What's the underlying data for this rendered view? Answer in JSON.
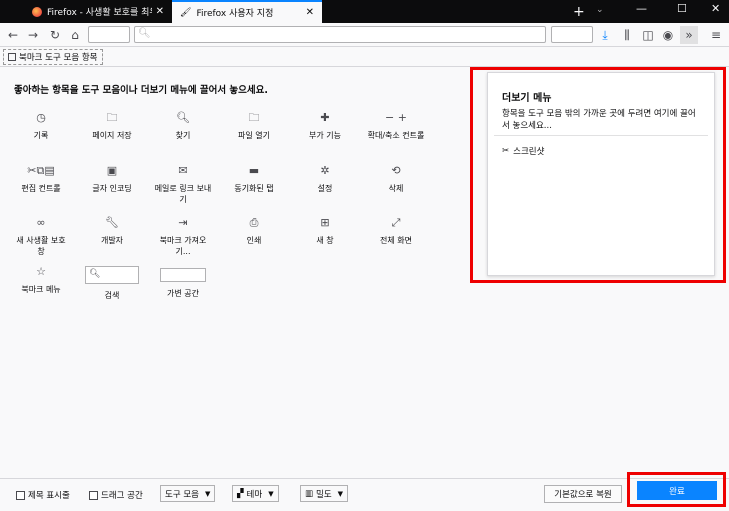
{
  "tabs": [
    {
      "title": "Firefox - 사생활 보호를 최우선"
    },
    {
      "title": "Firefox 사용자 지정"
    }
  ],
  "toolbar": {
    "new_tab": "+",
    "tab_menu": "⌄",
    "win_minimize": "—",
    "win_maximize": "☐",
    "win_close": "✕"
  },
  "bookmarks_toolbar": {
    "label": "북마크 도구 모음 항목"
  },
  "customize": {
    "heading": "좋아하는 항목을 도구 모음이나 더보기 메뉴에 끌어서 놓으세요.",
    "items": [
      {
        "label": "기록",
        "icon": "history-icon",
        "glyph": "◷"
      },
      {
        "label": "페이지 저장",
        "icon": "save-page-icon",
        "glyph": "🗀"
      },
      {
        "label": "찾기",
        "icon": "search-icon",
        "glyph": "🔍︎"
      },
      {
        "label": "파일 열기",
        "icon": "open-file-icon",
        "glyph": "🗀"
      },
      {
        "label": "부가 기능",
        "icon": "puzzle-icon",
        "glyph": "✚"
      },
      {
        "label": "확대/축소 컨트롤",
        "icon": "zoom-icon",
        "glyph": "−  +"
      },
      {
        "label": "편집 컨트롤",
        "icon": "edit-controls-icon",
        "glyph": "✂⧉▤"
      },
      {
        "label": "글자 인코딩",
        "icon": "encoding-icon",
        "glyph": "▣"
      },
      {
        "label": "메일로 링크 보내기",
        "icon": "mail-icon",
        "glyph": "✉"
      },
      {
        "label": "동기화된 탭",
        "icon": "synced-tabs-icon",
        "glyph": "▬"
      },
      {
        "label": "설정",
        "icon": "gear-icon",
        "glyph": "✲"
      },
      {
        "label": "삭제",
        "icon": "forget-icon",
        "glyph": "⟲"
      },
      {
        "label": "새 사생활 보호 창",
        "icon": "private-window-icon",
        "glyph": "∞"
      },
      {
        "label": "개발자",
        "icon": "wrench-icon",
        "glyph": "🔧︎"
      },
      {
        "label": "북마크 가져오기...",
        "icon": "import-bookmarks-icon",
        "glyph": "⇥"
      },
      {
        "label": "인쇄",
        "icon": "print-icon",
        "glyph": "⎙"
      },
      {
        "label": "새 창",
        "icon": "new-window-icon",
        "glyph": "⊞"
      },
      {
        "label": "전체 화면",
        "icon": "fullscreen-icon",
        "glyph": "⤢"
      },
      {
        "label": "북마크 메뉴",
        "icon": "bookmark-menu-icon",
        "glyph": "☆"
      },
      {
        "label": "검색",
        "icon": "search-widget",
        "glyph": ""
      },
      {
        "label": "가변 공간",
        "icon": "flexible-space-widget",
        "glyph": ""
      }
    ]
  },
  "overflow_menu": {
    "title": "더보기 메뉴",
    "description": "항목을 도구 모음 밖의 가까운 곳에 두려면 여기에 끌어서 놓으세요...",
    "items": [
      {
        "label": "스크린샷",
        "icon": "screenshot-icon"
      }
    ]
  },
  "footer": {
    "show_title": "제목 표시줄",
    "drag_space": "드래그 공간",
    "toolbars": "도구 모음",
    "themes": "테마",
    "density": "밀도",
    "restore_defaults": "기본값으로 복원",
    "done": "완료"
  },
  "colors": {
    "accent": "#0a84ff",
    "highlight": "#ee0000"
  }
}
